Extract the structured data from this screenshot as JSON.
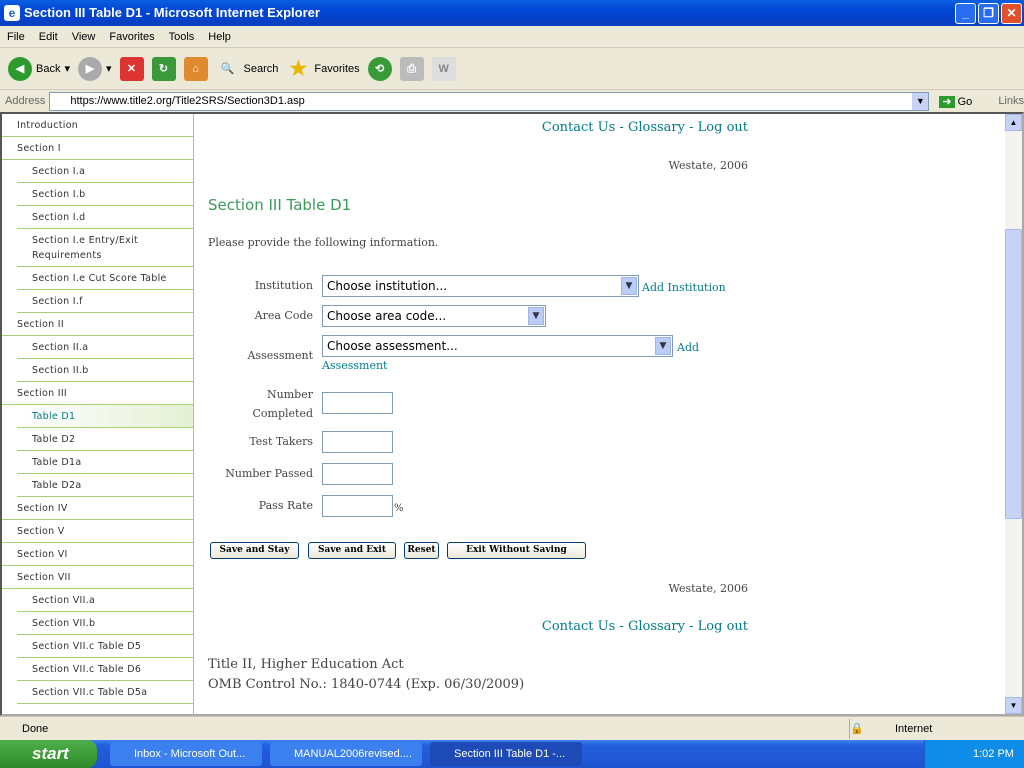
{
  "window": {
    "title": "Section III Table D1 - Microsoft Internet Explorer"
  },
  "menu": [
    "File",
    "Edit",
    "View",
    "Favorites",
    "Tools",
    "Help"
  ],
  "toolbar": {
    "back": "Back",
    "search": "Search",
    "favorites": "Favorites"
  },
  "address": {
    "label": "Address",
    "url": "https://www.title2.org/Title2SRS/Section3D1.asp",
    "go": "Go",
    "links": "Links"
  },
  "sidebar": [
    {
      "label": "Introduction",
      "level": 0
    },
    {
      "label": "Section I",
      "level": 0
    },
    {
      "label": "Section I.a",
      "level": 1
    },
    {
      "label": "Section I.b",
      "level": 1
    },
    {
      "label": "Section I.d",
      "level": 1
    },
    {
      "label": "Section I.e Entry/Exit Requirements",
      "level": 1
    },
    {
      "label": "Section I.e Cut Score Table",
      "level": 1
    },
    {
      "label": "Section I.f",
      "level": 1
    },
    {
      "label": "Section II",
      "level": 0
    },
    {
      "label": "Section II.a",
      "level": 1
    },
    {
      "label": "Section II.b",
      "level": 1
    },
    {
      "label": "Section III",
      "level": 0
    },
    {
      "label": "Table D1",
      "level": 1,
      "active": true
    },
    {
      "label": "Table D2",
      "level": 1
    },
    {
      "label": "Table D1a",
      "level": 1
    },
    {
      "label": "Table D2a",
      "level": 1
    },
    {
      "label": "Section IV",
      "level": 0
    },
    {
      "label": "Section V",
      "level": 0
    },
    {
      "label": "Section VI",
      "level": 0
    },
    {
      "label": "Section VII",
      "level": 0
    },
    {
      "label": "Section VII.a",
      "level": 1
    },
    {
      "label": "Section VII.b",
      "level": 1
    },
    {
      "label": "Section VII.c Table D5",
      "level": 1
    },
    {
      "label": "Section VII.c Table D6",
      "level": 1
    },
    {
      "label": "Section VII.c Table D5a",
      "level": 1
    }
  ],
  "links": {
    "contact": "Contact Us",
    "glossary": "Glossary",
    "logout": "Log out",
    "sep": " - "
  },
  "westate": "Westate, 2006",
  "page": {
    "title": "Section III Table D1",
    "intro": "Please provide the following information."
  },
  "form": {
    "institution": {
      "label": "Institution",
      "value": "Choose institution...",
      "add": "Add Institution"
    },
    "area_code": {
      "label": "Area Code",
      "value": "Choose area code..."
    },
    "assessment": {
      "label": "Assessment",
      "value": "Choose assessment...",
      "add1": "Add",
      "add2": "Assessment"
    },
    "number_completed": {
      "label1": "Number",
      "label2": "Completed"
    },
    "test_takers": {
      "label": "Test Takers"
    },
    "number_passed": {
      "label": "Number Passed"
    },
    "pass_rate": {
      "label": "Pass Rate",
      "unit": "%"
    },
    "buttons": {
      "save_stay": "Save and Stay",
      "save_exit": "Save and Exit",
      "reset": "Reset",
      "exit": "Exit Without Saving"
    }
  },
  "footer": {
    "line1": "Title II, Higher Education Act",
    "line2": "OMB Control No.: 1840-0744 (Exp. 06/30/2009)"
  },
  "status": {
    "text": "Done",
    "zone": "Internet"
  },
  "taskbar": {
    "start": "start",
    "tasks": [
      "Inbox - Microsoft Out...",
      "MANUAL2006revised....",
      "Section III Table D1 -..."
    ],
    "time": "1:02 PM"
  }
}
